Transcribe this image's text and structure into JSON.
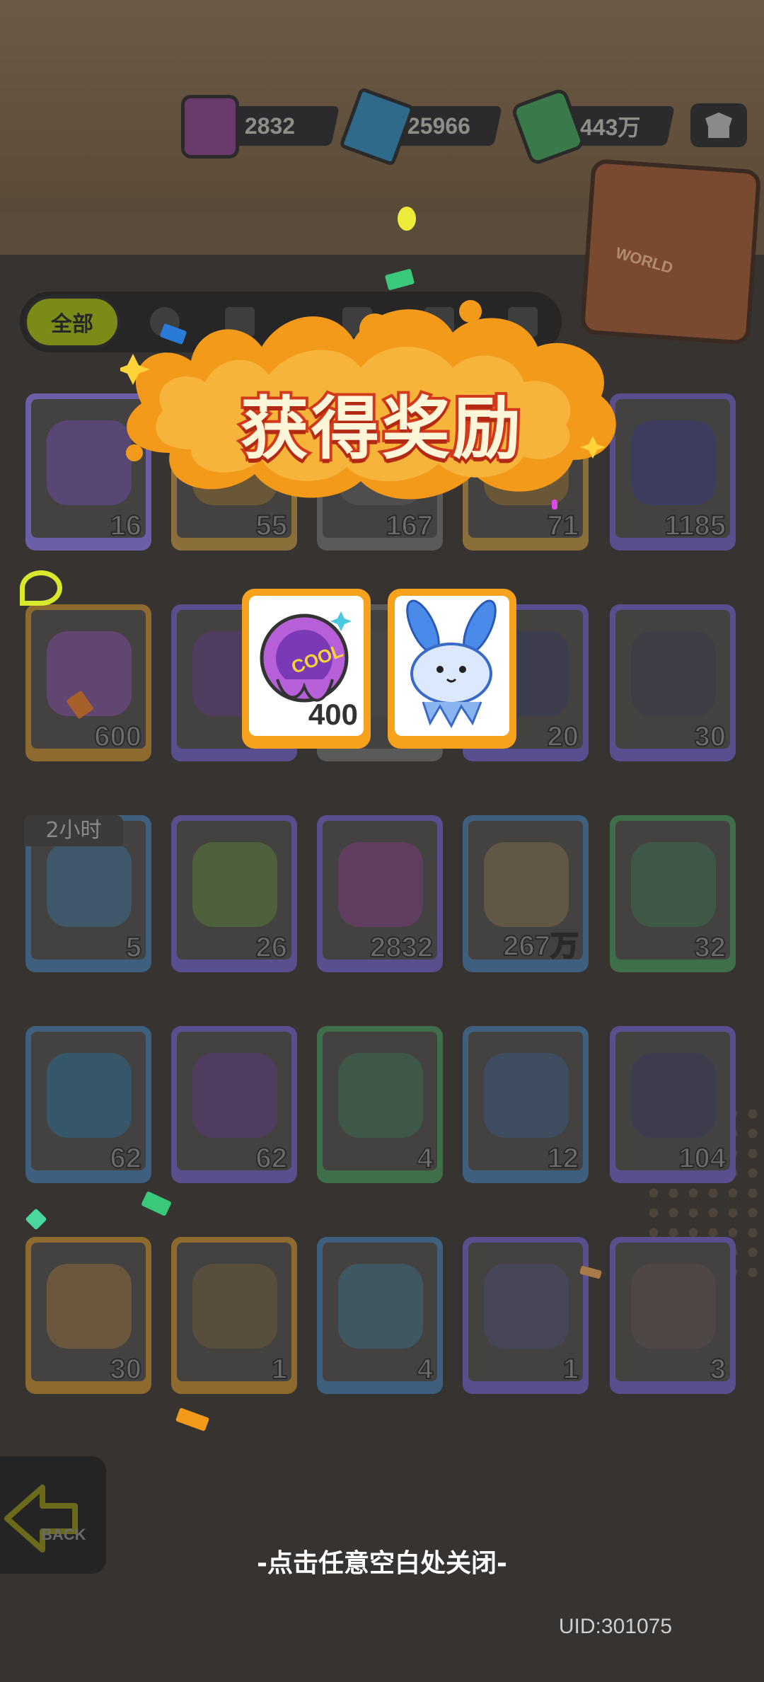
{
  "currency": {
    "spray": "2832",
    "diamond": "25966",
    "cash": "443万"
  },
  "world_label": "WORLD",
  "tabs": {
    "all": "全部"
  },
  "timer_badge": "2小时",
  "inventory": [
    {
      "count": "16",
      "color": "#6a4aa0",
      "border": "#6b5fa8"
    },
    {
      "count": "55",
      "color": "#8a6a30",
      "border": "#8a6f3a"
    },
    {
      "count": "167",
      "color": "#5a5a5a",
      "border": "#5a5a5a"
    },
    {
      "count": "71",
      "color": "#8a6a30",
      "border": "#8a6f3a"
    },
    {
      "count": "1185",
      "color": "#3a3a7a",
      "border": "#5a4f8e"
    },
    {
      "count": "600",
      "color": "#7a4a9a",
      "border": "#8e6a2e"
    },
    {
      "count": "",
      "color": "#5a3a7a",
      "border": "#5a4f8e"
    },
    {
      "count": "",
      "color": "#4a4a4a",
      "border": "#5a5a5a"
    },
    {
      "count": "20",
      "color": "#3a3a5a",
      "border": "#5a4f8e"
    },
    {
      "count": "30",
      "color": "#3a3a4a",
      "border": "#5a4f8e"
    },
    {
      "count": "5",
      "color": "#3a6a8a",
      "border": "#3f5f7e"
    },
    {
      "count": "26",
      "color": "#5a7a3a",
      "border": "#5a4f8e"
    },
    {
      "count": "2832",
      "color": "#7a3a7a",
      "border": "#5a4f8e"
    },
    {
      "count": "267万",
      "color": "#7a6a4a",
      "border": "#3f5f7e"
    },
    {
      "count": "32",
      "color": "#3a6a4a",
      "border": "#3f6e4a"
    },
    {
      "count": "62",
      "color": "#2a6a8a",
      "border": "#3f5f7e"
    },
    {
      "count": "62",
      "color": "#5a3a7a",
      "border": "#5a4f8e"
    },
    {
      "count": "4",
      "color": "#3a6a4a",
      "border": "#3f6e4a"
    },
    {
      "count": "12",
      "color": "#3a5a7a",
      "border": "#3f5f7e"
    },
    {
      "count": "104",
      "color": "#3a3a5a",
      "border": "#5a4f8e"
    },
    {
      "count": "30",
      "color": "#8a6a3a",
      "border": "#8e6a2e"
    },
    {
      "count": "1",
      "color": "#6a5a3a",
      "border": "#8e6a2e"
    },
    {
      "count": "4",
      "color": "#3a6a7a",
      "border": "#3f5f7e"
    },
    {
      "count": "1",
      "color": "#4a4a6a",
      "border": "#5a4f8e"
    },
    {
      "count": "3",
      "color": "#5a4a4a",
      "border": "#5a4f8e"
    }
  ],
  "popup": {
    "title": "获得奖励",
    "rewards": [
      {
        "name": "cool-badge",
        "qty": "400"
      },
      {
        "name": "blue-creature",
        "qty": ""
      }
    ],
    "close_hint": "-点击任意空白处关闭-"
  },
  "back_label": "BACK",
  "uid": "UID:301075"
}
